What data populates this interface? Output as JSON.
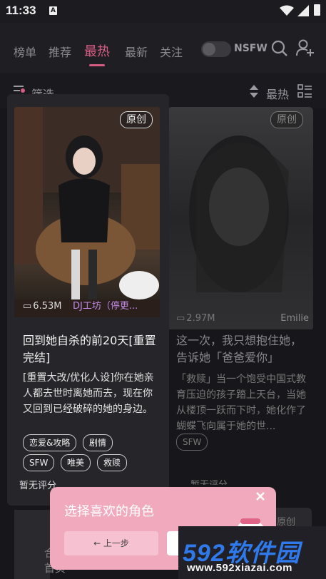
{
  "status_bar": {
    "time": "11:33",
    "notif_icon": "A"
  },
  "nav": {
    "tabs": [
      {
        "label": "榜单"
      },
      {
        "label": "推荐"
      },
      {
        "label": "最热",
        "active": true
      },
      {
        "label": "最新"
      },
      {
        "label": "关注"
      }
    ],
    "nsfw_label": "NSFW",
    "nsfw_enabled": false,
    "accent_color": "#d85b82"
  },
  "filter": {
    "label": "筛选",
    "sort_label": "最热"
  },
  "cards": [
    {
      "badge": "原创",
      "comments": "6.53M",
      "author": "DJ工坊（停更...",
      "title": "回到她自杀的前20天[重置完结]",
      "desc": "[重置大改/优化人设]你在她亲人都去世时离她而去，现在你又回到已经破碎的她的身边。",
      "tags": [
        "恋爱&攻略",
        "剧情",
        "SFW",
        "唯美",
        "救赎"
      ],
      "rating": "暂无评分"
    },
    {
      "badge": "原创",
      "comments": "2.97M",
      "author": "Emilie",
      "title": "这一次，我只想抱住她，告诉她「爸爸爱你」",
      "desc": "「救赎」当一个饱受中国式教育压迫的孩子踏上天台，当她从楼顶一跃而下时，她化作了蝴蝶飞向属于她的世...",
      "tags": [
        "SFW"
      ],
      "rating": "暂无评分"
    }
  ],
  "bottom": {
    "badge": "原创",
    "text1": "合",
    "text2": "首页"
  },
  "popup": {
    "title": "选择喜欢的角色",
    "prev_label": "← 上一步"
  },
  "watermark": {
    "logo": "592软件园",
    "url": "www.592xiazai.com"
  }
}
